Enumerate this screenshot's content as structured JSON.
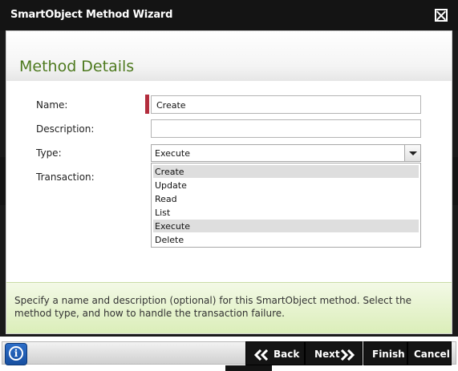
{
  "window": {
    "title": "SmartObject Method Wizard"
  },
  "page": {
    "title": "Method Details"
  },
  "form": {
    "name_label": "Name:",
    "name_value": "Create",
    "description_label": "Description:",
    "description_value": "",
    "type_label": "Type:",
    "type_value": "Execute",
    "transaction_label": "Transaction:"
  },
  "type_options": [
    "Create",
    "Update",
    "Read",
    "List",
    "Execute",
    "Delete"
  ],
  "hint": "Specify a name and description (optional) for this SmartObject method. Select the method type, and how to handle the transaction failure.",
  "buttons": {
    "back": "Back",
    "next": "Next",
    "finish": "Finish",
    "cancel": "Cancel"
  },
  "icons": {
    "close": "close-icon",
    "info": "info-icon"
  },
  "colors": {
    "accent_title": "#4e7a1f",
    "required_marker": "#b32d3d",
    "chrome": "#141414"
  }
}
